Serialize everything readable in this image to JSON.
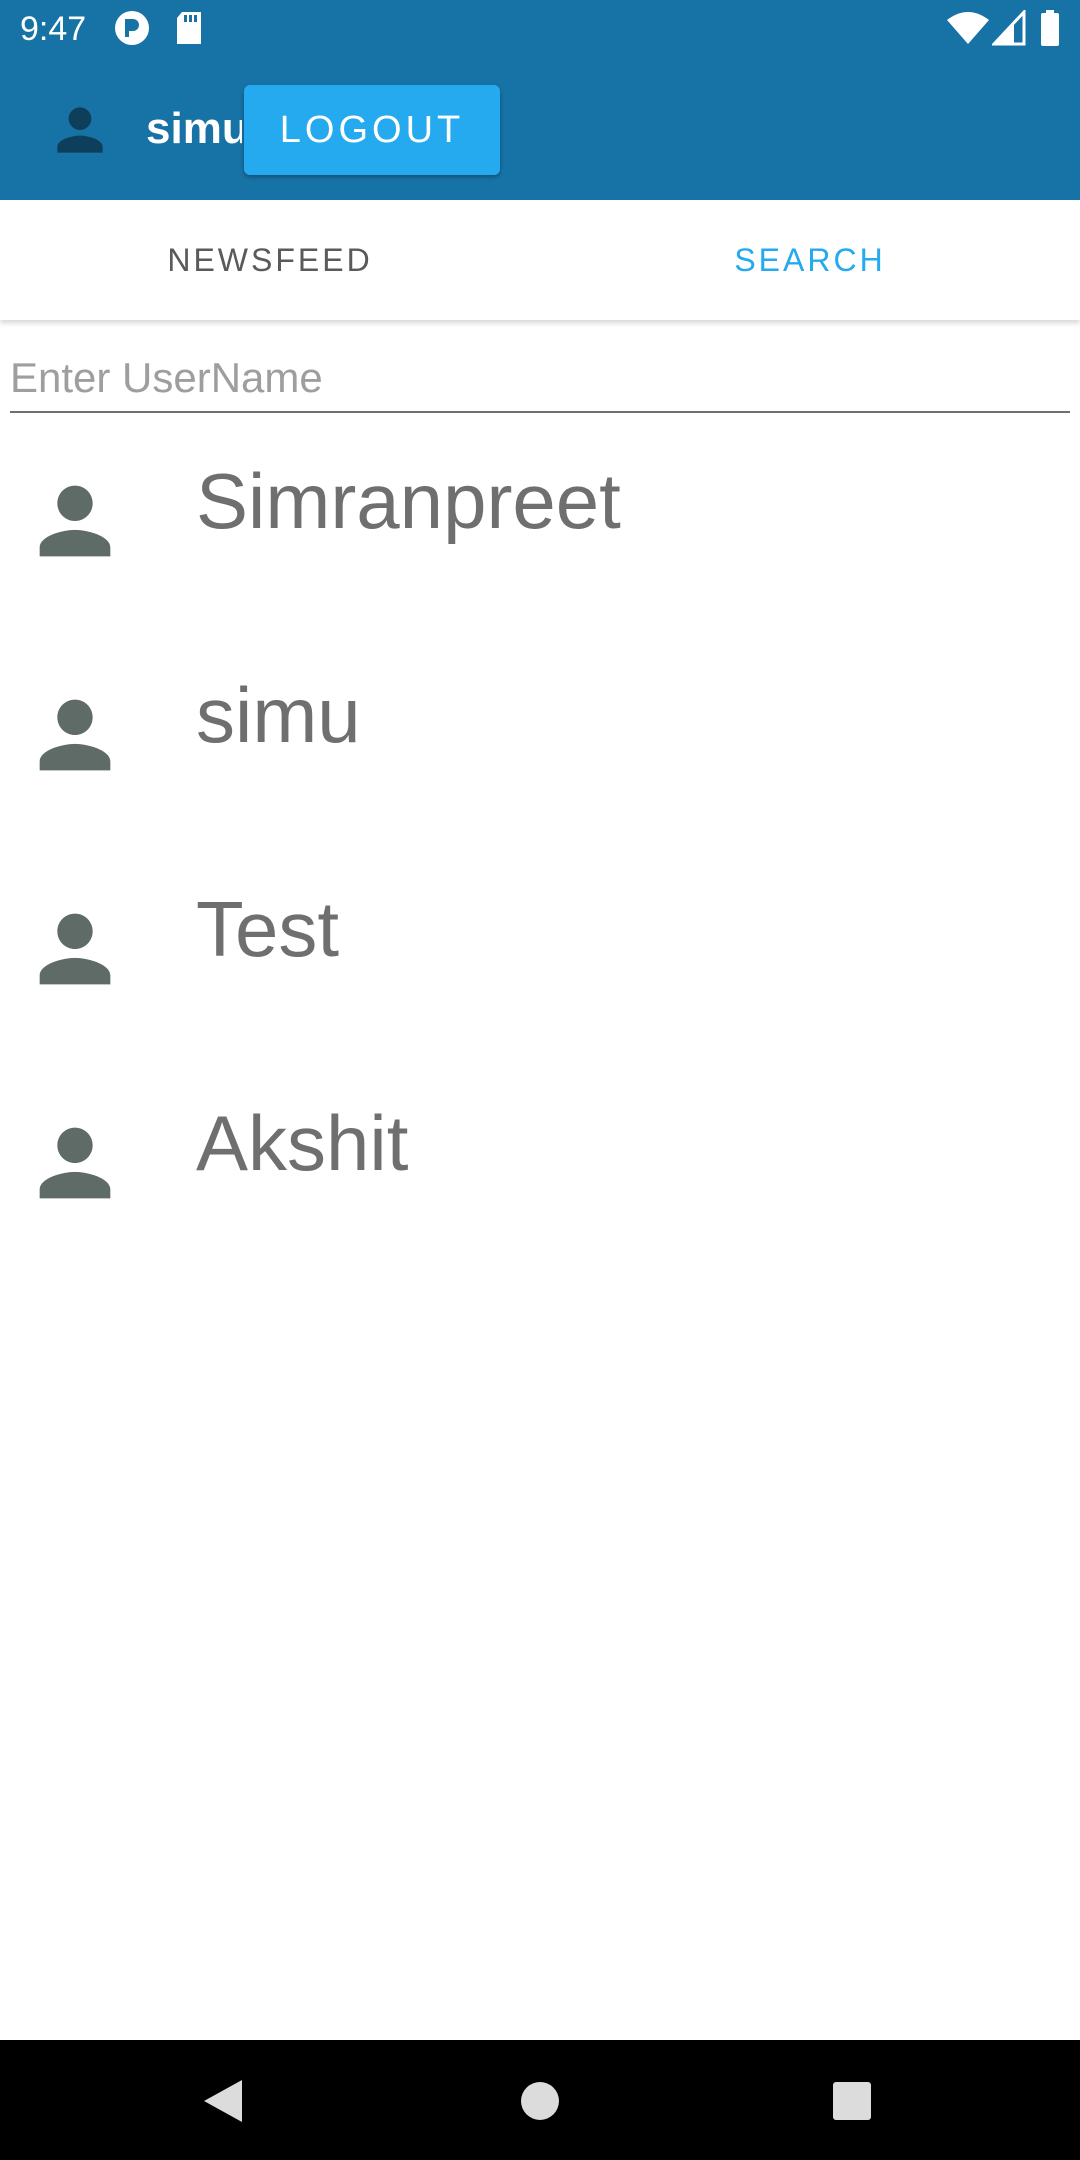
{
  "status_bar": {
    "time": "9:47",
    "icons": [
      "notification-app-icon",
      "sd-card-icon",
      "wifi-icon",
      "signal-icon",
      "battery-icon"
    ]
  },
  "app_bar": {
    "username": "simu",
    "logout_label": "LOGOUT",
    "avatar_icon": "account-icon"
  },
  "tabs": [
    {
      "label": "NEWSFEED",
      "selected": false
    },
    {
      "label": "SEARCH",
      "selected": true
    }
  ],
  "search": {
    "placeholder": "Enter UserName",
    "value": ""
  },
  "users": [
    {
      "name": "Simranpreet"
    },
    {
      "name": "simu"
    },
    {
      "name": "Test"
    },
    {
      "name": "Akshit"
    }
  ],
  "nav_bar": {
    "buttons": [
      "back-icon",
      "home-icon",
      "recents-icon"
    ]
  },
  "colors": {
    "primary": "#1773a6",
    "accent": "#25a9ef",
    "avatar_gray": "#5f6b66"
  }
}
